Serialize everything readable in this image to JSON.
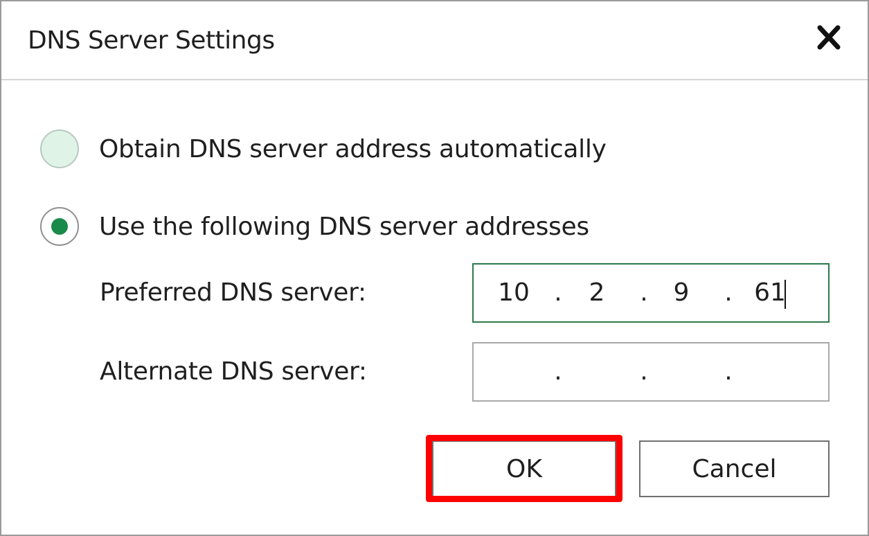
{
  "dialog": {
    "title": "DNS Server Settings"
  },
  "options": [
    {
      "label": "Obtain DNS server address automatically",
      "checked": false
    },
    {
      "label": "Use the following DNS server addresses",
      "checked": true
    }
  ],
  "preferred": {
    "label": "Preferred DNS server:",
    "octets": [
      "10",
      "2",
      "9",
      "61"
    ],
    "focused": true
  },
  "alternate": {
    "label": "Alternate DNS server:",
    "octets": [
      "",
      "",
      "",
      ""
    ]
  },
  "buttons": {
    "ok": "OK",
    "cancel": "Cancel"
  },
  "ip_separator": ".",
  "colors": {
    "accent_green": "#1a8a4a",
    "highlight_red": "#ff0000"
  }
}
